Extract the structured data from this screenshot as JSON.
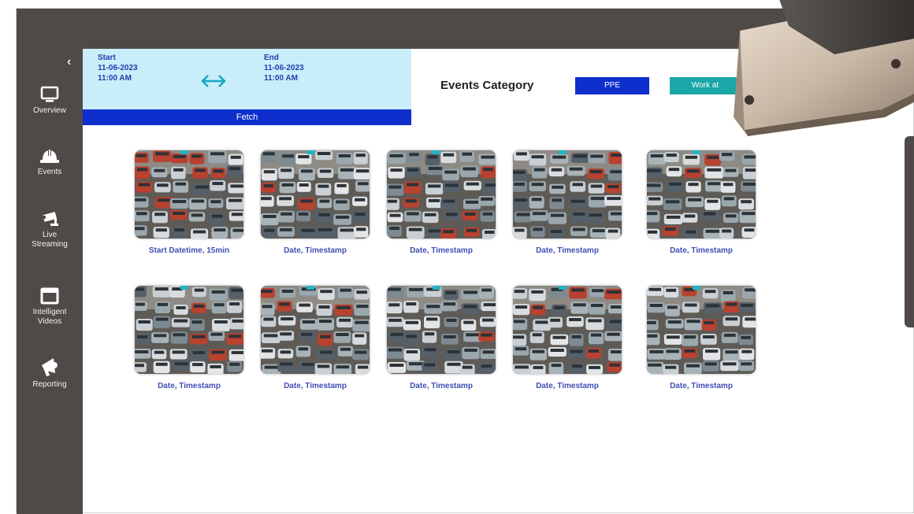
{
  "sidebar": {
    "collapse_glyph": "‹",
    "items": [
      {
        "label": "Overview",
        "icon": "monitor-icon"
      },
      {
        "label": "Events",
        "icon": "hard-hat-icon"
      },
      {
        "label": "Live\nStreaming",
        "icon": "cctv-camera-icon"
      },
      {
        "label": "Intelligent\nVideos",
        "icon": "folder-icon"
      },
      {
        "label": "Reporting",
        "icon": "megaphone-icon"
      }
    ]
  },
  "range": {
    "start_label": "Start",
    "start_date": "11-06-2023",
    "start_time": "11:00 AM",
    "swap_glyph": "⟷",
    "end_label": "End",
    "end_date": "11-06-2023",
    "end_time": "11:00 AM",
    "fetch_label": "Fetch"
  },
  "events": {
    "title": "Events Category",
    "chips": [
      "PPE",
      "Work at"
    ]
  },
  "thumbnails": [
    {
      "caption": "Start Datetime, 15min"
    },
    {
      "caption": "Date, Timestamp"
    },
    {
      "caption": "Date, Timestamp"
    },
    {
      "caption": "Date, Timestamp"
    },
    {
      "caption": "Date, Timestamp"
    },
    {
      "caption": "Date, Timestamp"
    },
    {
      "caption": "Date, Timestamp"
    },
    {
      "caption": "Date, Timestamp"
    },
    {
      "caption": "Date, Timestamp"
    },
    {
      "caption": "Date, Timestamp"
    }
  ],
  "colors": {
    "sidebar_bg": "#4f4a47",
    "date_panel_bg": "#c9eef9",
    "fetch_bg": "#0e2fcc",
    "ppe_chip": "#0e2fcc",
    "work_chip": "#1aa7a7",
    "caption_text": "#3f4fb3"
  }
}
